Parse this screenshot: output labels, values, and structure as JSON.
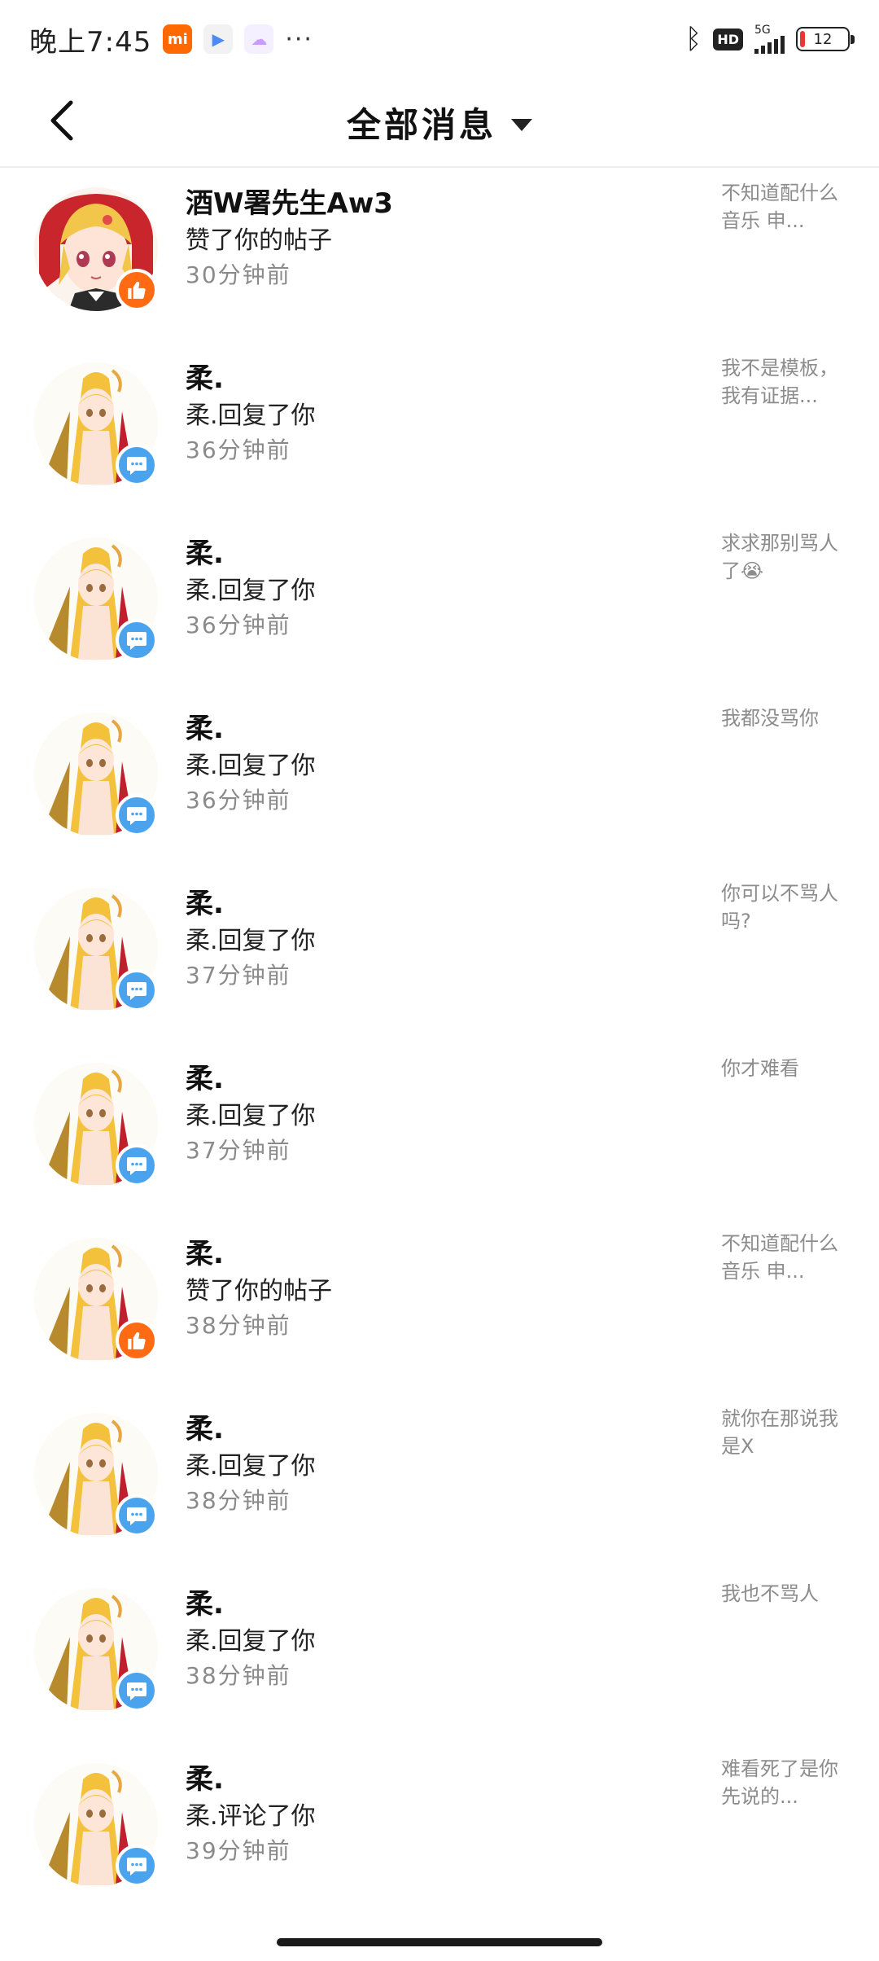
{
  "status_bar": {
    "time": "晚上7:45",
    "app_icons": [
      "mi-icon",
      "play-icon",
      "cloud-icon"
    ],
    "more": "···",
    "hd": "HD",
    "network": "5G",
    "battery": "12"
  },
  "header": {
    "title": "全部消息"
  },
  "notifications": [
    {
      "name": "酒W署先生Aw3",
      "action": "赞了你的帖子",
      "time": "30分钟前",
      "preview": "不知道配什么音乐 申...",
      "type": "like",
      "avatar": "avatar-a"
    },
    {
      "name": "柔.",
      "action": "柔.回复了你",
      "time": "36分钟前",
      "preview": "我不是模板，我有证据...",
      "type": "comment",
      "avatar": "avatar-b"
    },
    {
      "name": "柔.",
      "action": "柔.回复了你",
      "time": "36分钟前",
      "preview": "求求那别骂人了😭",
      "type": "comment",
      "avatar": "avatar-b"
    },
    {
      "name": "柔.",
      "action": "柔.回复了你",
      "time": "36分钟前",
      "preview": "我都没骂你",
      "type": "comment",
      "avatar": "avatar-b"
    },
    {
      "name": "柔.",
      "action": "柔.回复了你",
      "time": "37分钟前",
      "preview": "你可以不骂人吗?",
      "type": "comment",
      "avatar": "avatar-b"
    },
    {
      "name": "柔.",
      "action": "柔.回复了你",
      "time": "37分钟前",
      "preview": "你才难看",
      "type": "comment",
      "avatar": "avatar-b"
    },
    {
      "name": "柔.",
      "action": "赞了你的帖子",
      "time": "38分钟前",
      "preview": "不知道配什么音乐 申...",
      "type": "like",
      "avatar": "avatar-b"
    },
    {
      "name": "柔.",
      "action": "柔.回复了你",
      "time": "38分钟前",
      "preview": "就你在那说我是X",
      "type": "comment",
      "avatar": "avatar-b"
    },
    {
      "name": "柔.",
      "action": "柔.回复了你",
      "time": "38分钟前",
      "preview": "我也不骂人",
      "type": "comment",
      "avatar": "avatar-b"
    },
    {
      "name": "柔.",
      "action": "柔.评论了你",
      "time": "39分钟前",
      "preview": "难看死了是你先说的...",
      "type": "comment",
      "avatar": "avatar-b"
    }
  ]
}
